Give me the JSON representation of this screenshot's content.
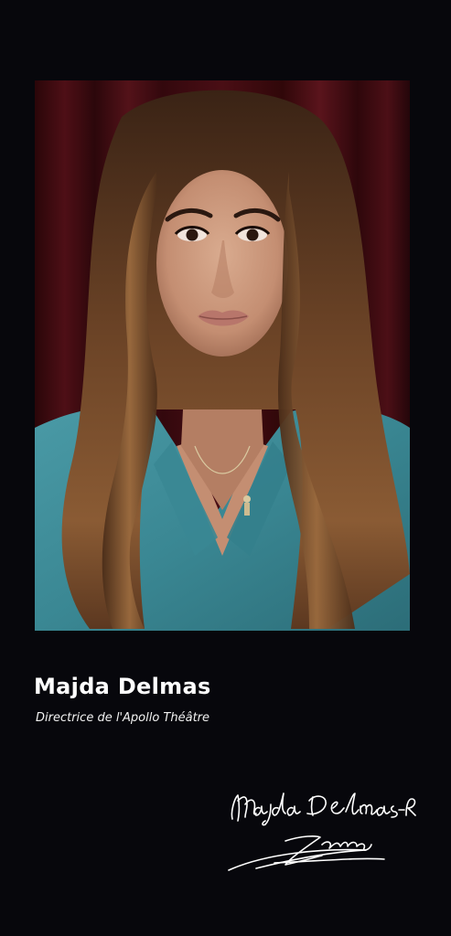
{
  "profile": {
    "name": "Majda Delmas",
    "role": "Directrice de l'Apollo Théâtre"
  },
  "signature": {
    "text": "Majda Delmas-Rida"
  },
  "colors": {
    "background": "#07070c",
    "curtain": "#4a0d14",
    "shirt": "#3f8e9a",
    "hair": "#6b4326",
    "text": "#ffffff"
  }
}
